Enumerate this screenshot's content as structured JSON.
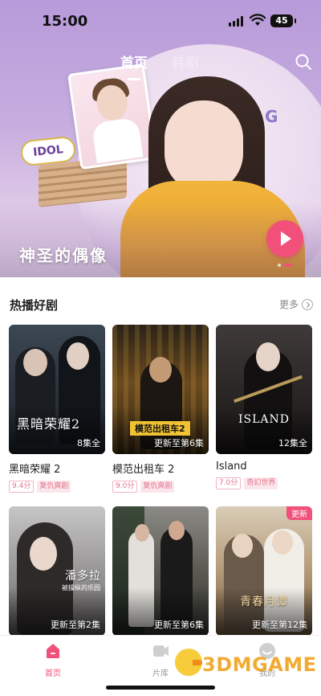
{
  "status_bar": {
    "time": "15:00",
    "battery": "45"
  },
  "top_tabs": [
    {
      "label": "首页",
      "active": true
    },
    {
      "label": "韩剧",
      "active": false
    }
  ],
  "hero": {
    "title": "神圣的偶像",
    "badge_text": "IDOL",
    "slide_count": 2,
    "active_slide": 2
  },
  "section": {
    "title": "热播好剧",
    "more_label": "更多"
  },
  "shows": [
    {
      "title": "黑暗荣耀 2",
      "poster_caption": "黑暗荣耀2",
      "badge": "8集全",
      "score": "9.4分",
      "genre": "复仇爽剧"
    },
    {
      "title": "模范出租车 2",
      "poster_caption": "模范出租车2",
      "badge": "更新至第6集",
      "score": "9.0分",
      "genre": "复仇爽剧"
    },
    {
      "title": "Island",
      "poster_caption": "ISLAND",
      "badge": "12集全",
      "score": "7.0分",
      "genre": "奇幻世界"
    },
    {
      "poster_caption": "潘多拉",
      "poster_subcaption": "被操纵的乐园",
      "badge": "更新至第2集"
    },
    {
      "badge": "更新至第6集"
    },
    {
      "poster_caption": "青春月谭",
      "badge": "更新至第12集",
      "new_tag": "更新"
    }
  ],
  "bottom_nav": [
    {
      "label": "首页",
      "active": true
    },
    {
      "label": "片库",
      "active": false
    },
    {
      "label": "我的",
      "active": false
    }
  ],
  "watermark": {
    "text": "3DMGAME"
  },
  "colors": {
    "accent": "#f0507a",
    "hero_purple": "#b79ad9"
  }
}
